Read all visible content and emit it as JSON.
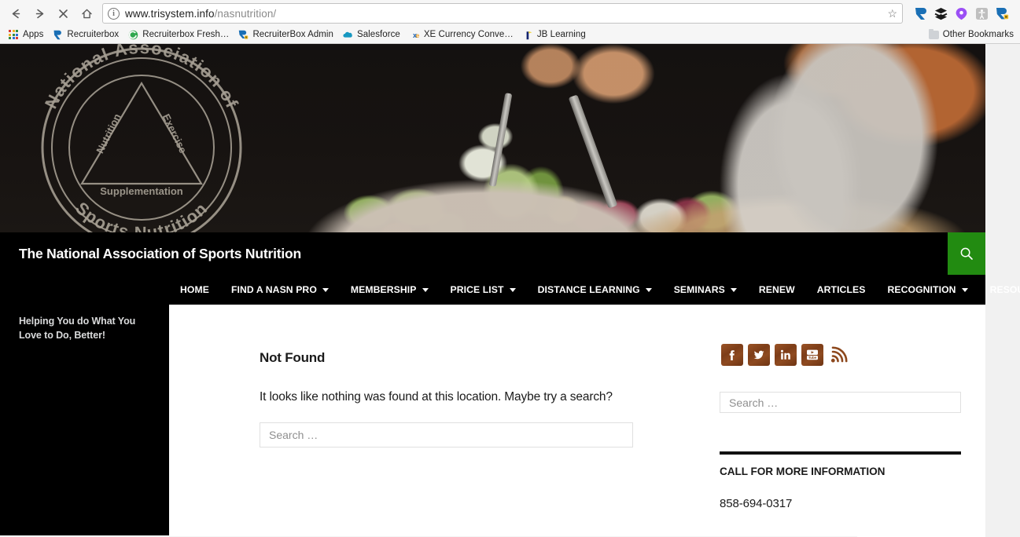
{
  "browser": {
    "back_icon": "back-arrow-icon",
    "forward_icon": "forward-arrow-icon",
    "stop_icon": "stop-icon",
    "home_icon": "home-icon",
    "info_glyph": "i",
    "url_host": "www.trisystem.info",
    "url_path": "/nasnutrition/",
    "star_glyph": "☆",
    "extensions": [
      {
        "name": "recruiterbox-extension-icon"
      },
      {
        "name": "layers-extension-icon"
      },
      {
        "name": "lastpass-extension-icon"
      },
      {
        "name": "accessibility-extension-icon"
      },
      {
        "name": "recruiterbox-admin-extension-icon"
      }
    ],
    "bookmarks": [
      {
        "label": "Apps",
        "icon": "apps-grid-icon"
      },
      {
        "label": "Recruiterbox",
        "icon": "recruiterbox-icon"
      },
      {
        "label": "Recruiterbox Fresh…",
        "icon": "recruiterbox-fresh-icon"
      },
      {
        "label": "RecruiterBox Admin",
        "icon": "recruiterbox-admin-icon"
      },
      {
        "label": "Salesforce",
        "icon": "salesforce-cloud-icon"
      },
      {
        "label": "XE Currency Conve…",
        "icon": "xe-icon"
      },
      {
        "label": "JB Learning",
        "icon": "jb-learning-icon"
      }
    ],
    "other_bookmarks_label": "Other Bookmarks"
  },
  "hero": {
    "logo": {
      "ring_text_top": "National Association of",
      "ring_text_bottom": "Sports Nutrition",
      "label_left": "Nutrition",
      "label_right": "Exercise",
      "label_bottom": "Supplementation"
    },
    "photo_alt": "Person tossing a bowl of salad in a kitchen"
  },
  "site": {
    "title": "The National Association of Sports Nutrition",
    "tagline": "Helping You do What You Love to Do, Better!",
    "search_button_icon": "search-icon",
    "accent_green": "#228b11",
    "header_bg": "#000000"
  },
  "nav": {
    "items": [
      {
        "label": "HOME",
        "has_dropdown": false
      },
      {
        "label": "FIND A NASN PRO",
        "has_dropdown": true
      },
      {
        "label": "MEMBERSHIP",
        "has_dropdown": true
      },
      {
        "label": "PRICE LIST",
        "has_dropdown": true
      },
      {
        "label": "DISTANCE LEARNING",
        "has_dropdown": true
      },
      {
        "label": "SEMINARS",
        "has_dropdown": true
      },
      {
        "label": "RENEW",
        "has_dropdown": false
      },
      {
        "label": "ARTICLES",
        "has_dropdown": false
      },
      {
        "label": "RECOGNITION",
        "has_dropdown": true
      },
      {
        "label": "RESOURCES",
        "has_dropdown": true
      }
    ]
  },
  "main": {
    "title": "Not Found",
    "message": "It looks like nothing was found at this location. Maybe try a search?",
    "search_placeholder": "Search …"
  },
  "sidebar": {
    "social": [
      {
        "name": "facebook-icon",
        "glyph": "f"
      },
      {
        "name": "twitter-icon",
        "glyph": "t"
      },
      {
        "name": "linkedin-icon",
        "glyph": "in"
      },
      {
        "name": "youtube-icon",
        "glyph": "yt"
      },
      {
        "name": "rss-icon",
        "glyph": "rss"
      }
    ],
    "search_placeholder": "Search …",
    "call_heading": "CALL FOR MORE INFORMATION",
    "phone": "858-694-0317"
  }
}
